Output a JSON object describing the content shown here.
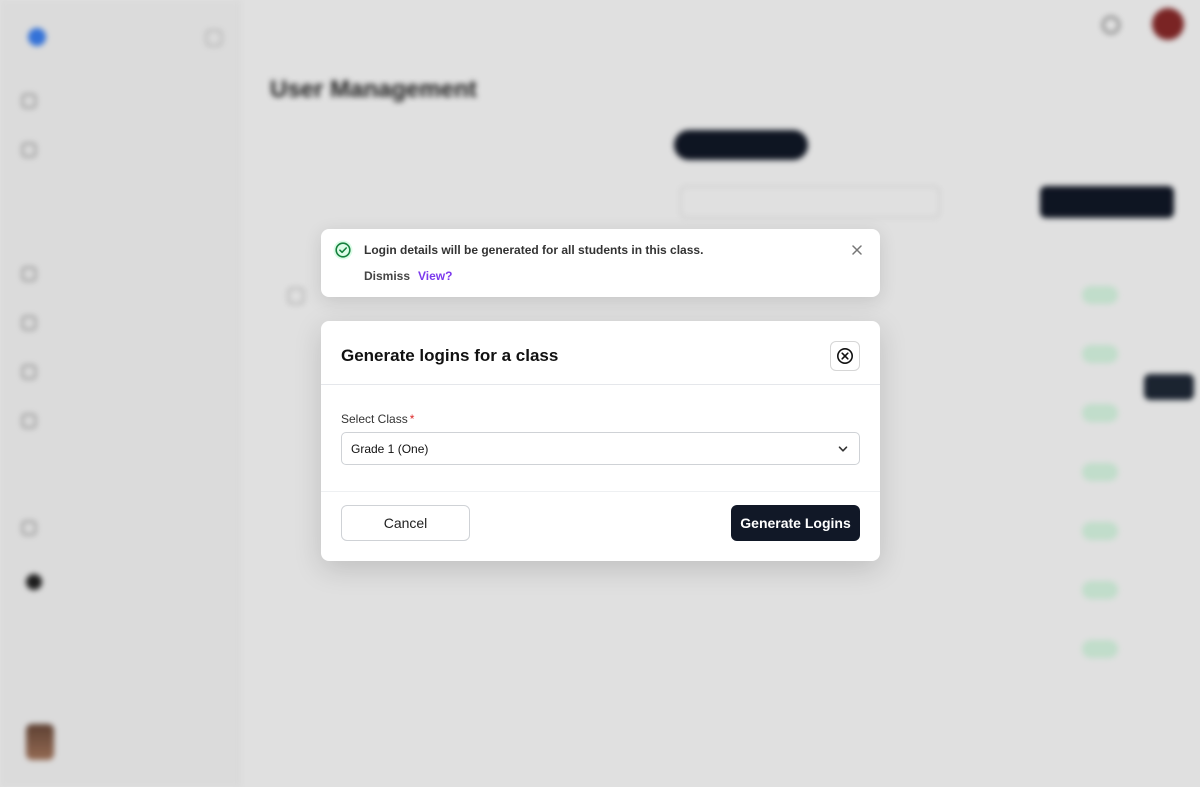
{
  "toast": {
    "message": "Login details will be generated for all students in this class.",
    "dismiss_label": "Dismiss",
    "view_label": "View?",
    "success_color": "#16a34a",
    "link_color": "#7c3aed"
  },
  "modal": {
    "title": "Generate logins for a class",
    "field_label": "Select Class",
    "required_mark": "*",
    "selected_class": "Grade 1 (One)",
    "cancel_label": "Cancel",
    "generate_label": "Generate Logins",
    "primary_color": "#111827"
  },
  "page": {
    "title": "User Management"
  }
}
